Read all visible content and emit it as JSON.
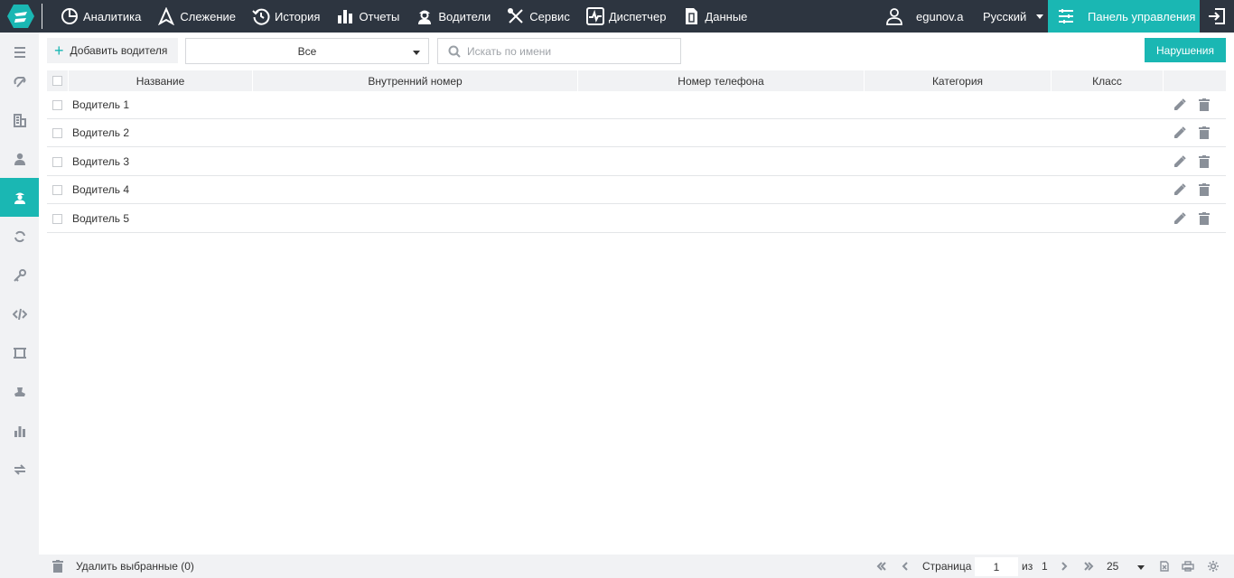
{
  "nav": {
    "items": [
      {
        "label": "Аналитика",
        "icon": "analytics-icon"
      },
      {
        "label": "Слежение",
        "icon": "tracking-arrow-icon"
      },
      {
        "label": "История",
        "icon": "history-icon"
      },
      {
        "label": "Отчеты",
        "icon": "bar-chart-icon"
      },
      {
        "label": "Водители",
        "icon": "driver-icon"
      },
      {
        "label": "Сервис",
        "icon": "tools-icon"
      },
      {
        "label": "Диспетчер",
        "icon": "pulse-icon"
      },
      {
        "label": "Данные",
        "icon": "document-icon"
      }
    ],
    "username": "egunov.a",
    "language": "Русский",
    "control_panel": "Панель управления"
  },
  "sidebar": {
    "active": "drivers",
    "items": [
      "menu-icon",
      "sensor-icon",
      "buildings-icon",
      "user-icon",
      "driver-icon",
      "refresh-icon",
      "key-icon",
      "code-icon",
      "crop-icon",
      "stamp-icon",
      "chart-icon",
      "transfer-icon"
    ]
  },
  "toolbar": {
    "add_label": "Добавить водителя",
    "filter_value": "Все",
    "search_placeholder": "Искать по имени",
    "violations_label": "Нарушения"
  },
  "table": {
    "columns": [
      "Название",
      "Внутренний номер",
      "Номер телефона",
      "Категория",
      "Класс"
    ],
    "rows": [
      {
        "name": "Водитель 1",
        "internal_number": "",
        "phone": "",
        "category": "",
        "class": ""
      },
      {
        "name": "Водитель 2",
        "internal_number": "",
        "phone": "",
        "category": "",
        "class": ""
      },
      {
        "name": "Водитель 3",
        "internal_number": "",
        "phone": "",
        "category": "",
        "class": ""
      },
      {
        "name": "Водитель 4",
        "internal_number": "",
        "phone": "",
        "category": "",
        "class": ""
      },
      {
        "name": "Водитель 5",
        "internal_number": "",
        "phone": "",
        "category": "",
        "class": ""
      }
    ]
  },
  "footer": {
    "delete_selected": "Удалить выбранные (0)",
    "page_label": "Страница",
    "page_value": "1",
    "of_label": "из",
    "total_pages": "1",
    "page_size": "25"
  },
  "colors": {
    "topbar": "#2d3540",
    "accent": "#1ab7b3",
    "panel": "#f1f2f4"
  }
}
